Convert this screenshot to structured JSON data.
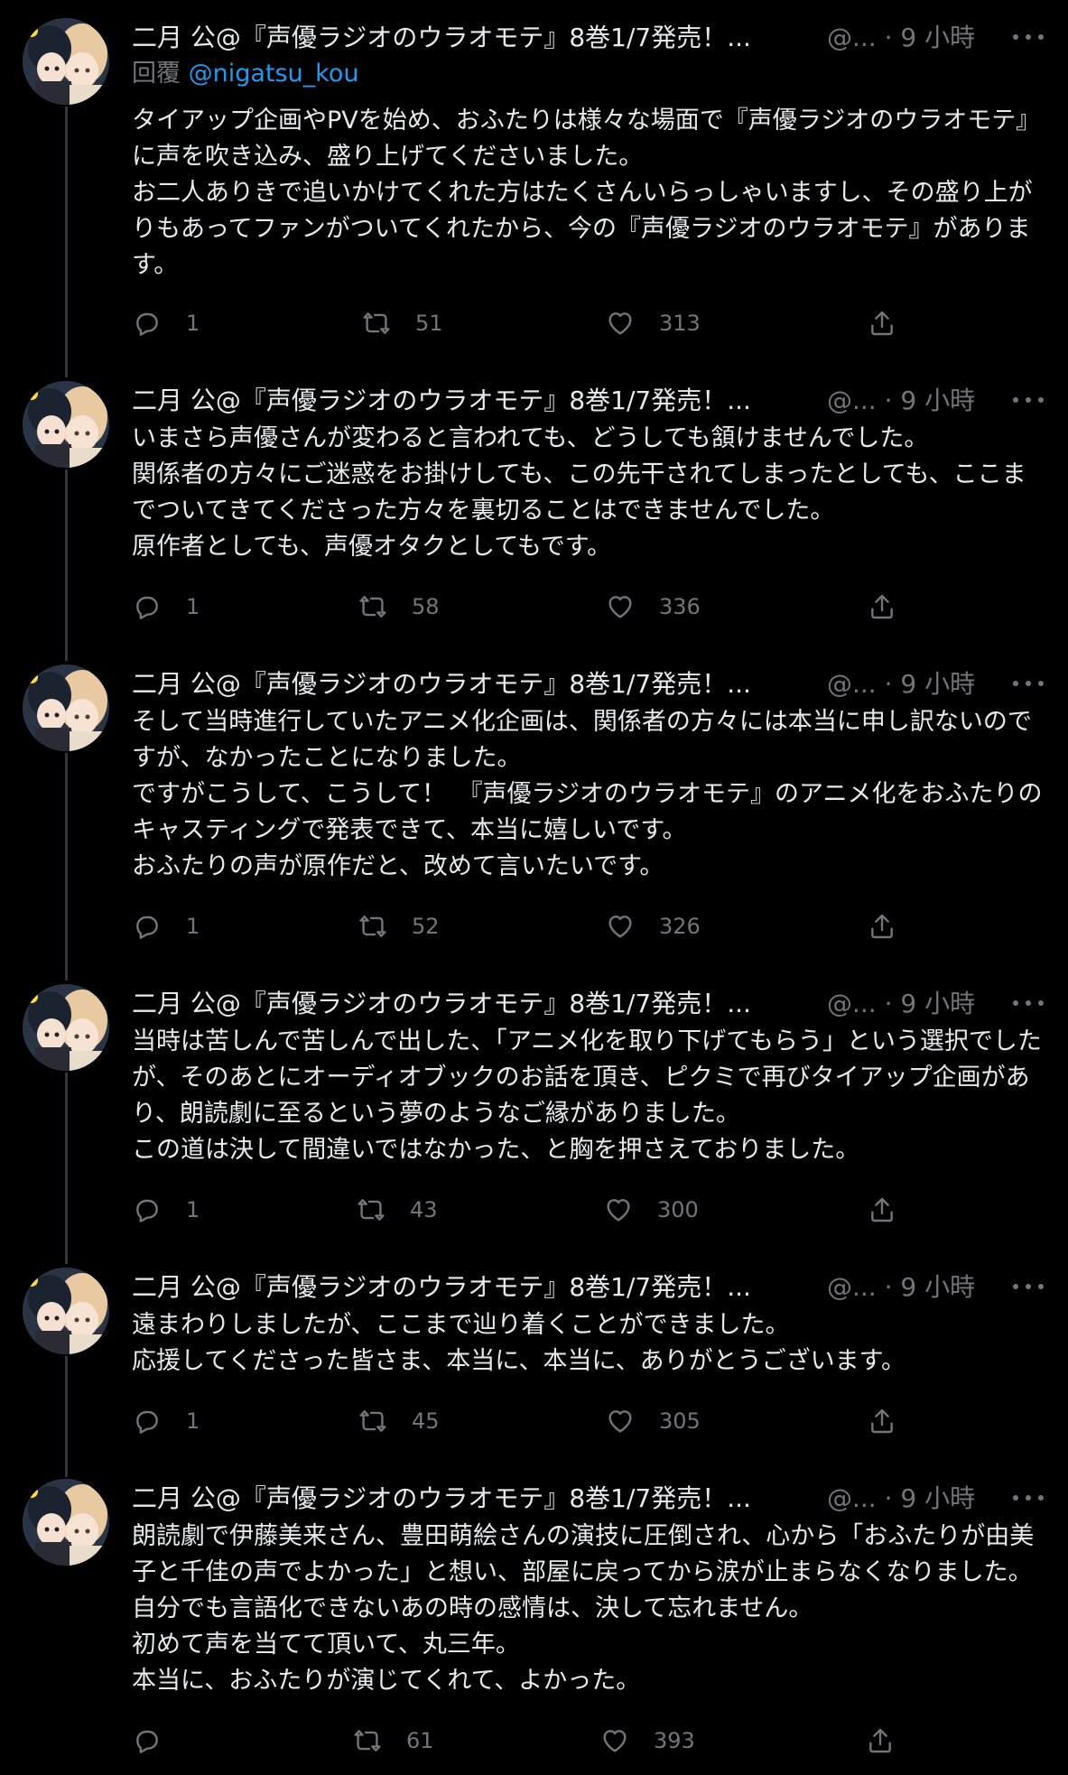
{
  "tweets": [
    {
      "name": "二月 公@『声優ラジオのウラオモテ』8巻1/7発売！...",
      "handle": "@... · 9 小時",
      "reply_label": "回覆",
      "reply_to": "@nigatsu_kou",
      "text": "タイアップ企画やPVを始め、おふたりは様々な場面で『声優ラジオのウラオモテ』に声を吹き込み、盛り上げてくださいました。\nお二人ありきで追いかけてくれた方はたくさんいらっしゃいますし、その盛り上がりもあってファンがついてくれたから、今の『声優ラジオのウラオモテ』があります。",
      "replies": "1",
      "retweets": "51",
      "likes": "313"
    },
    {
      "name": "二月 公@『声優ラジオのウラオモテ』8巻1/7発売！...",
      "handle": "@... · 9 小時",
      "text": "いまさら声優さんが変わると言われても、どうしても頷けませんでした。\n関係者の方々にご迷惑をお掛けしても、この先干されてしまったとしても、ここまでついてきてくださった方々を裏切ることはできませんでした。\n原作者としても、声優オタクとしてもです。",
      "replies": "1",
      "retweets": "58",
      "likes": "336"
    },
    {
      "name": "二月 公@『声優ラジオのウラオモテ』8巻1/7発売！...",
      "handle": "@... · 9 小時",
      "text": "そして当時進行していたアニメ化企画は、関係者の方々には本当に申し訳ないのですが、なかったことになりました。\nですがこうして、こうして！　『声優ラジオのウラオモテ』のアニメ化をおふたりのキャスティングで発表できて、本当に嬉しいです。\nおふたりの声が原作だと、改めて言いたいです。",
      "replies": "1",
      "retweets": "52",
      "likes": "326"
    },
    {
      "name": "二月 公@『声優ラジオのウラオモテ』8巻1/7発売！...",
      "handle": "@... · 9 小時",
      "text": "当時は苦しんで苦しんで出した、「アニメ化を取り下げてもらう」という選択でしたが、そのあとにオーディオブックのお話を頂き、ピクミで再びタイアップ企画があり、朗読劇に至るという夢のようなご縁がありました。\nこの道は決して間違いではなかった、と胸を押さえておりました。",
      "replies": "1",
      "retweets": "43",
      "likes": "300"
    },
    {
      "name": "二月 公@『声優ラジオのウラオモテ』8巻1/7発売！...",
      "handle": "@... · 9 小時",
      "text": "遠まわりしましたが、ここまで辿り着くことができました。\n応援してくださった皆さま、本当に、本当に、ありがとうございます。",
      "replies": "1",
      "retweets": "45",
      "likes": "305"
    },
    {
      "name": "二月 公@『声優ラジオのウラオモテ』8巻1/7発売！...",
      "handle": "@... · 9 小時",
      "text": "朗読劇で伊藤美来さん、豊田萌絵さんの演技に圧倒され、心から「おふたりが由美子と千佳の声でよかった」と想い、部屋に戻ってから涙が止まらなくなりました。自分でも言語化できないあの時の感情は、決して忘れません。\n初めて声を当てて頂いて、丸三年。\n本当に、おふたりが演じてくれて、よかった。",
      "replies": "",
      "retweets": "61",
      "likes": "393"
    }
  ],
  "colors": {
    "background": "#000000",
    "text": "#e7e9ea",
    "muted": "#71767b",
    "link": "#1d9bf0",
    "thread_line": "#333639"
  }
}
